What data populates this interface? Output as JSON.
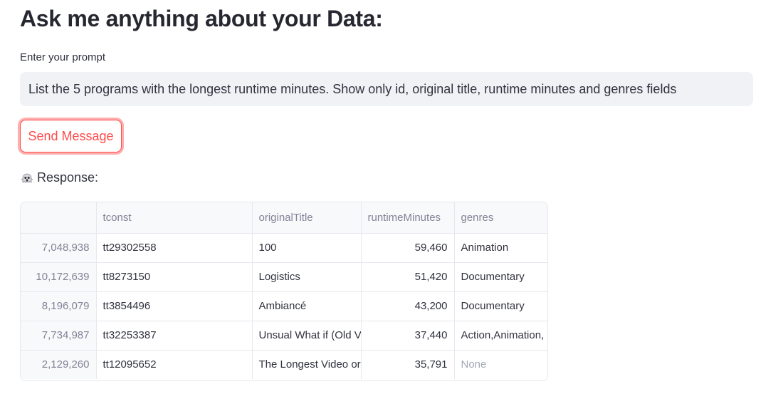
{
  "header": {
    "title": "Ask me anything about your Data:"
  },
  "prompt": {
    "label": "Enter your prompt",
    "value": "List the 5 programs with the longest runtime minutes. Show only id, original title, runtime minutes and genres fields"
  },
  "send_button": {
    "label": "Send Message",
    "accent_color": "#ff4b4b"
  },
  "response": {
    "icon": "ghost-icon",
    "label": "Response:"
  },
  "table": {
    "columns": [
      "",
      "tconst",
      "originalTitle",
      "runtimeMinutes",
      "genres"
    ],
    "rows": [
      {
        "index": "7,048,938",
        "tconst": "tt29302558",
        "originalTitle": "100",
        "runtimeMinutes": "59,460",
        "genres": "Animation"
      },
      {
        "index": "10,172,639",
        "tconst": "tt8273150",
        "originalTitle": "Logistics",
        "runtimeMinutes": "51,420",
        "genres": "Documentary"
      },
      {
        "index": "8,196,079",
        "tconst": "tt3854496",
        "originalTitle": "Ambiancé",
        "runtimeMinutes": "43,200",
        "genres": "Documentary"
      },
      {
        "index": "7,734,987",
        "tconst": "tt32253387",
        "originalTitle": "Unsual What if (Old V",
        "runtimeMinutes": "37,440",
        "genres": "Action,Animation,"
      },
      {
        "index": "2,129,260",
        "tconst": "tt12095652",
        "originalTitle": "The Longest Video or",
        "runtimeMinutes": "35,791",
        "genres": "None"
      }
    ]
  }
}
